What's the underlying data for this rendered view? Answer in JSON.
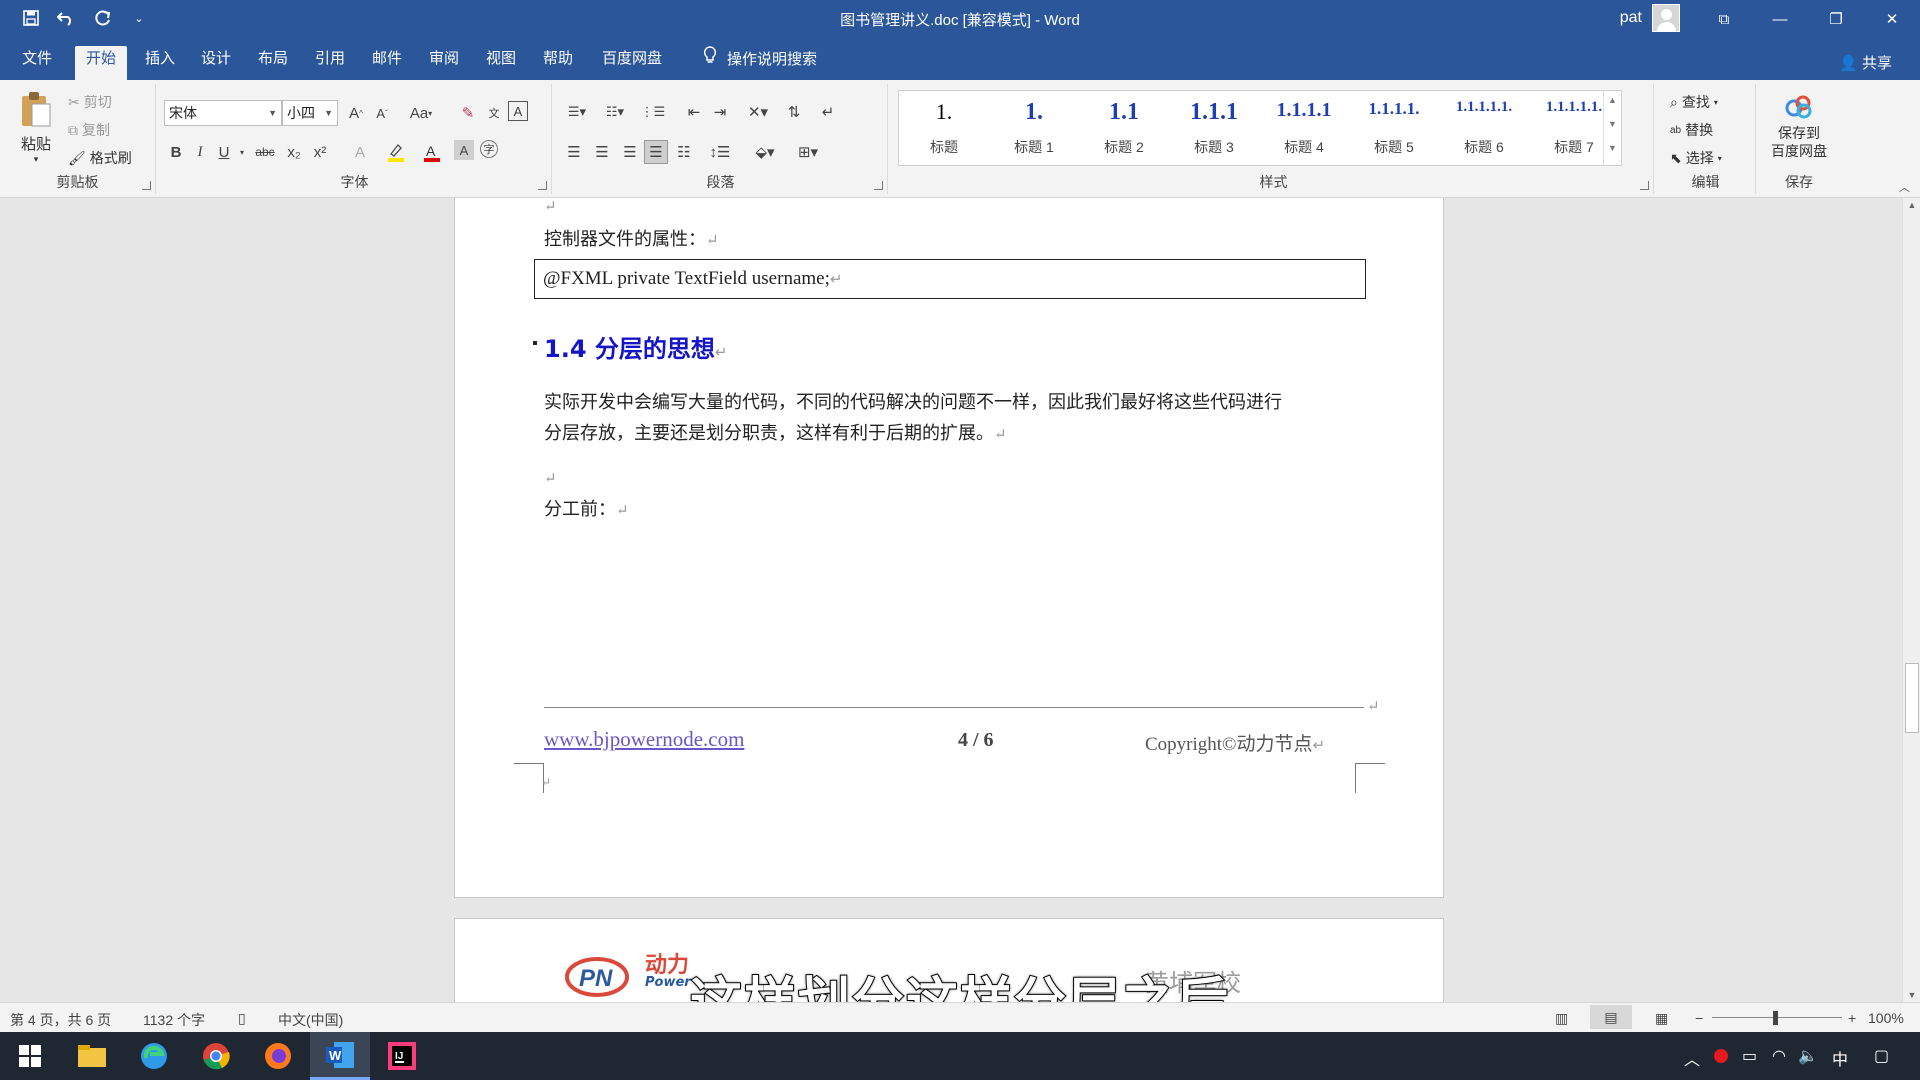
{
  "window": {
    "title": "图书管理讲义.doc [兼容模式] - Word",
    "user": "pat",
    "controls": [
      "⧉",
      "—",
      "❐",
      "✕"
    ]
  },
  "qat": {
    "customize": "⌄"
  },
  "tabs": [
    "文件",
    "开始",
    "插入",
    "设计",
    "布局",
    "引用",
    "邮件",
    "审阅",
    "视图",
    "帮助",
    "百度网盘",
    "操作说明搜索"
  ],
  "active_tab": "开始",
  "share": "共享",
  "clipboard": {
    "paste": "粘贴",
    "cut": "剪切",
    "copy": "复制",
    "format_painter": "格式刷",
    "label": "剪贴板"
  },
  "font": {
    "name": "宋体",
    "size": "小四",
    "label": "字体",
    "buttons": {
      "grow": "A",
      "shrink": "A",
      "case": "Aa",
      "bold": "B",
      "italic": "I",
      "underline": "U",
      "strike": "abc",
      "sub": "x₂",
      "sup": "x²"
    }
  },
  "paragraph": {
    "label": "段落"
  },
  "styles": {
    "label": "样式",
    "items": [
      {
        "preview": "1.",
        "name": "标题",
        "plain": true
      },
      {
        "preview": "1.",
        "name": "标题 1",
        "plain": false
      },
      {
        "preview": "1.1",
        "name": "标题 2",
        "plain": false
      },
      {
        "preview": "1.1.1",
        "name": "标题 3",
        "plain": false
      },
      {
        "preview": "1.1.1.1",
        "name": "标题 4",
        "plain": false
      },
      {
        "preview": "1.1.1.1.",
        "name": "标题 5",
        "plain": false
      },
      {
        "preview": "1.1.1.1.1.",
        "name": "标题 6",
        "plain": false
      },
      {
        "preview": "1.1.1.1.1.",
        "name": "标题 7",
        "plain": false
      }
    ]
  },
  "editing": {
    "find": "查找",
    "replace": "替换",
    "select": "选择",
    "label": "编辑"
  },
  "save": {
    "label1": "保存到",
    "label2": "百度网盘",
    "group": "保存"
  },
  "document": {
    "line_controller": "控制器文件的属性：",
    "code": "@FXML private TextField username;",
    "heading": "1.4 分层的思想",
    "para_line1": "实际开发中会编写大量的代码，不同的代码解决的问题不一样，因此我们最好将这些代码进行",
    "para_line2": "分层存放，主要还是划分职责，这样有利于后期的扩展。",
    "before_split": "分工前：",
    "return_mark": "↵",
    "footer_link": "www.bjpowernode.com",
    "footer_page": "4 / 6",
    "footer_copy": "Copyright©动力节点",
    "next_page_brand": "动力",
    "next_page_brand_sub": "Power",
    "next_page_right": "黄埔军校"
  },
  "subtitle": "这样划分这样分层之后",
  "status": {
    "page": "第 4 页，共 6 页",
    "words": "1132 个字",
    "lang": "中文(中国)",
    "zoom": "100%"
  },
  "taskbar": {
    "ime": "中"
  },
  "colors": {
    "word_blue": "#2b579a",
    "heading_blue": "#1515c8",
    "style_blue": "#1f3fae"
  }
}
